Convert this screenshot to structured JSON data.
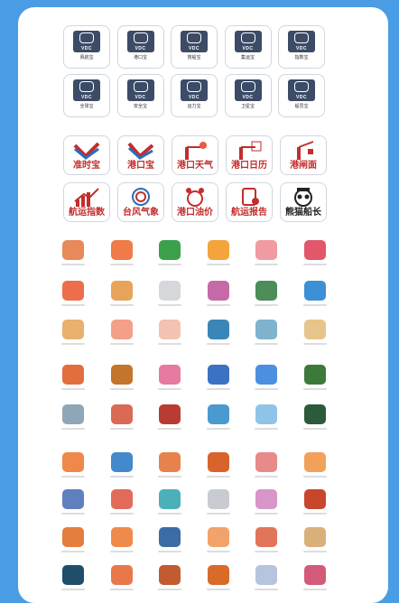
{
  "vdc_row1": [
    {
      "badge": "VDC",
      "label": "佩航宝",
      "icon": "ship-icon"
    },
    {
      "badge": "VDC",
      "label": "港口宝",
      "icon": "port-icon"
    },
    {
      "badge": "VDC",
      "label": "搜船宝",
      "icon": "search-icon"
    },
    {
      "badge": "VDC",
      "label": "集运宝",
      "icon": "container-icon"
    },
    {
      "badge": "VDC",
      "label": "指数宝",
      "icon": "chart-icon"
    }
  ],
  "vdc_row2": [
    {
      "badge": "VDC",
      "label": "全球宝",
      "icon": "globe-icon"
    },
    {
      "badge": "VDC",
      "label": "安全宝",
      "icon": "shield-icon"
    },
    {
      "badge": "VDC",
      "label": "运力宝",
      "icon": "capacity-icon"
    },
    {
      "badge": "VDC",
      "label": "卫星宝",
      "icon": "satellite-icon"
    },
    {
      "badge": "VDC",
      "label": "船员宝",
      "icon": "crew-icon"
    }
  ],
  "app_row1": [
    {
      "label": "准时宝",
      "icon": "on-time-icon",
      "color": "#c22d2d"
    },
    {
      "label": "港口宝",
      "icon": "port-treasure-icon",
      "color": "#c22d2d"
    },
    {
      "label": "港口天气",
      "icon": "port-weather-icon",
      "color": "#c22d2d"
    },
    {
      "label": "港口日历",
      "icon": "port-calendar-icon",
      "color": "#c22d2d"
    },
    {
      "label": "港闸面",
      "icon": "port-gate-icon",
      "color": "#c22d2d"
    }
  ],
  "app_row2": [
    {
      "label": "航运指数",
      "icon": "shipping-index-icon",
      "color": "#c22d2d"
    },
    {
      "label": "台风气象",
      "icon": "typhoon-icon",
      "color": "#c22d2d"
    },
    {
      "label": "港口油价",
      "icon": "oil-price-icon",
      "color": "#c22d2d"
    },
    {
      "label": "航运报告",
      "icon": "shipping-report-icon",
      "color": "#c22d2d"
    },
    {
      "label": "熊猫船长",
      "icon": "panda-captain-icon",
      "color": "#222222"
    }
  ],
  "grid_rows": [
    [
      "#e8895a",
      "#f07a48",
      "#3aa04a",
      "#f3a43a",
      "#f09aa2",
      "#e3576b"
    ],
    [
      "#ec6e4c",
      "#e8a35a",
      "#d5d7da",
      "#c56aa6",
      "#4e8c5a",
      "#3d8fd6"
    ],
    [
      "#e9b070",
      "#f4a088",
      "#f3c2b0",
      "#3a86b8",
      "#7fb2cc",
      "#e7c58a"
    ],
    [
      "#e26e3e",
      "#c5742c",
      "#e77aa0",
      "#3b72c4",
      "#4c8fe0",
      "#3c7a3a"
    ],
    [
      "#8fa6b6",
      "#d96a55",
      "#b83c33",
      "#4a9ad0",
      "#8fc4e8",
      "#2d5a3a"
    ],
    [
      "#f0884a",
      "#4489cc",
      "#e8824d",
      "#d8642c",
      "#e98a8a",
      "#f2a15a"
    ],
    [
      "#5f7fbf",
      "#e26a5a",
      "#4bb0b8",
      "#c8ccd2",
      "#d895c8",
      "#c8472c"
    ],
    [
      "#e57d3c",
      "#f08a4a",
      "#3b6ca6",
      "#f1a36a",
      "#e2745a",
      "#d9b07a"
    ],
    [
      "#1f4e6a",
      "#e8784a",
      "#c25a32",
      "#d86a2a",
      "#b7c4de",
      "#d45a7a"
    ]
  ]
}
